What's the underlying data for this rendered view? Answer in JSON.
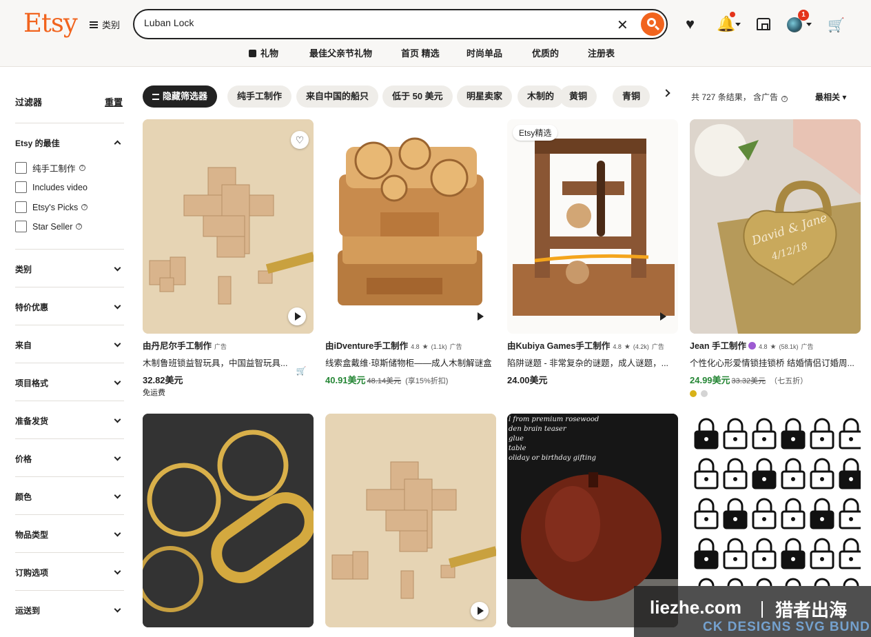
{
  "header": {
    "logo": "Etsy",
    "categories_label": "类别",
    "search": {
      "value": "Luban Lock",
      "placeholder": ""
    },
    "account_badge": "1",
    "brand_color": "#f1641e"
  },
  "subnav": [
    "礼物",
    "最佳父亲节礼物",
    "首页 精选",
    "时尚单品",
    "优质的",
    "注册表"
  ],
  "sidebar": {
    "title": "过滤器",
    "reset": "重置",
    "best_group": "Etsy 的最佳",
    "checkboxes": [
      "纯手工制作",
      "Includes video",
      "Etsy's Picks",
      "Star Seller"
    ],
    "groups": [
      "类别",
      "特价优惠",
      "来自",
      "项目格式",
      "准备发货",
      "价格",
      "颜色",
      "物品类型",
      "订购选项",
      "运送到"
    ]
  },
  "chips": [
    "隐藏筛选器",
    "纯手工制作",
    "来自中国的船只",
    "低于 50 美元",
    "明星卖家",
    "木制的",
    "黄铜",
    "青铜"
  ],
  "results": "共 727 条结果， 含广告",
  "sort": "最相关",
  "products": [
    {
      "badge": "",
      "shop": "由丹尼尔手工制作",
      "rating": "",
      "reviews": "",
      "ad": "广告",
      "title": "木制鲁班锁益智玩具，中国益智玩具...",
      "price": "32.82美元",
      "old_price": "",
      "discount": "",
      "shipping": "免运费"
    },
    {
      "badge": "",
      "shop": "由iDventure手工制作",
      "rating": "4.8",
      "reviews": "(1.1k)",
      "ad": "广告",
      "title": "线索盒戴维·琼斯储物柜——成人木制解谜盒",
      "price": "40.91美元",
      "old_price": "48.14美元",
      "discount": "(享15%折扣)",
      "shipping": ""
    },
    {
      "badge": "Etsy精选",
      "shop": "由Kubiya Games手工制作",
      "rating": "4.8",
      "reviews": "(4.2k)",
      "ad": "广告",
      "title": "陷阱谜题 - 非常复杂的谜题，成人谜题，...",
      "price": "24.00美元",
      "old_price": "",
      "discount": "",
      "shipping": ""
    },
    {
      "badge": "",
      "shop": "Jean 手工制作",
      "rating": "4.8",
      "reviews": "(58.1k)",
      "ad": "广告",
      "title": "个性化心形爱情锁挂锁桥 结婚情侣订婚周...",
      "price": "24.99美元",
      "old_price": "33.32美元",
      "discount": "（七五折）",
      "shipping": ""
    }
  ],
  "lock_engraving": [
    "David & Jane",
    "4/12/18"
  ],
  "apple_caption": [
    "l from premium rosewood",
    "den brain teaser",
    "glue",
    "table",
    "oliday or birthday gifting"
  ],
  "watermark": {
    "site": "liezhe.com",
    "cn": "猎者出海",
    "banner": "CK DESIGNS SVG BUND"
  }
}
